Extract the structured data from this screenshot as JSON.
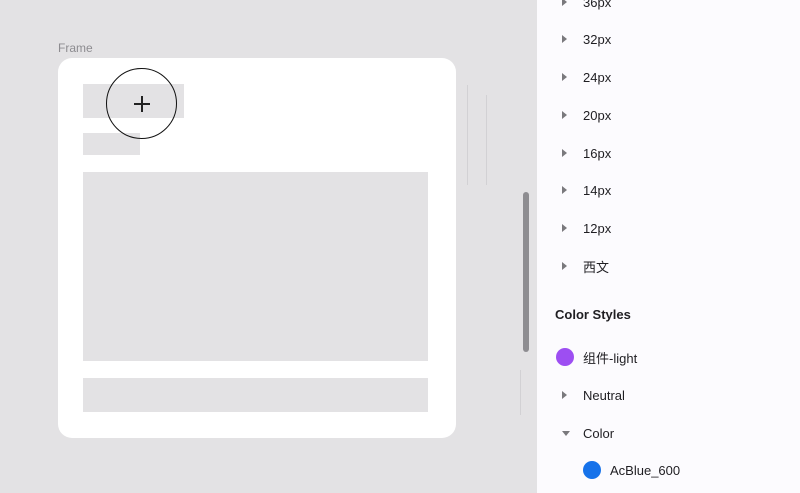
{
  "canvas": {
    "frame_label": "Frame"
  },
  "panel": {
    "text_styles": [
      {
        "label": "36px"
      },
      {
        "label": "32px"
      },
      {
        "label": "24px"
      },
      {
        "label": "20px"
      },
      {
        "label": "16px"
      },
      {
        "label": "14px"
      },
      {
        "label": "12px"
      },
      {
        "label": "西文"
      }
    ],
    "color_styles_title": "Color Styles",
    "color_styles": [
      {
        "label": "组件-light",
        "color": "#9d4ef2",
        "kind": "swatch"
      },
      {
        "label": "Neutral",
        "kind": "group-collapsed"
      },
      {
        "label": "Color",
        "kind": "group-expanded"
      },
      {
        "label": "AcBlue_600",
        "color": "#1672ea",
        "kind": "swatch-nested"
      }
    ]
  },
  "icons": {
    "cursor": "crosshair-plus-icon",
    "collapsed": "caret-right-icon",
    "expanded": "caret-down-icon"
  }
}
